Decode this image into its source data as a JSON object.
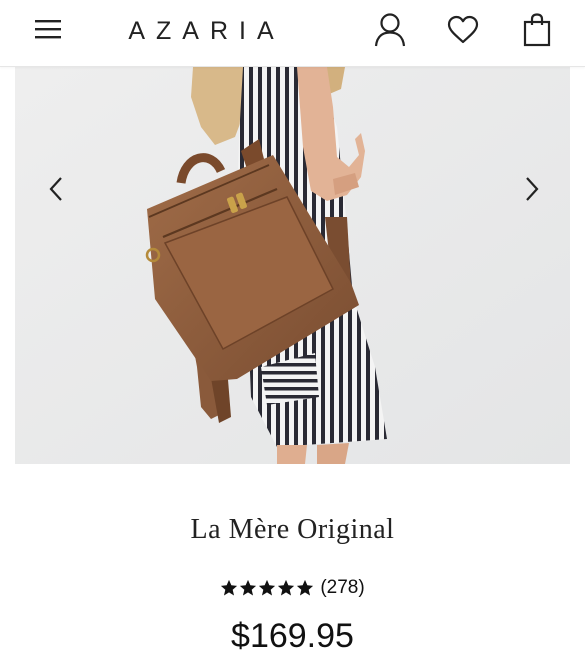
{
  "header": {
    "brand": "AZARIA",
    "icons": [
      "menu-icon",
      "account-icon",
      "heart-icon",
      "shopping-bag-icon"
    ]
  },
  "gallery": {
    "prev_icon": "chevron-left-icon",
    "next_icon": "chevron-right-icon"
  },
  "product": {
    "title": "La Mère Original",
    "rating": 5,
    "review_count": "(278)",
    "price": "$169.95"
  },
  "colors": {
    "leather": "#8a5a3b",
    "text": "#111111",
    "background": "#ffffff"
  }
}
